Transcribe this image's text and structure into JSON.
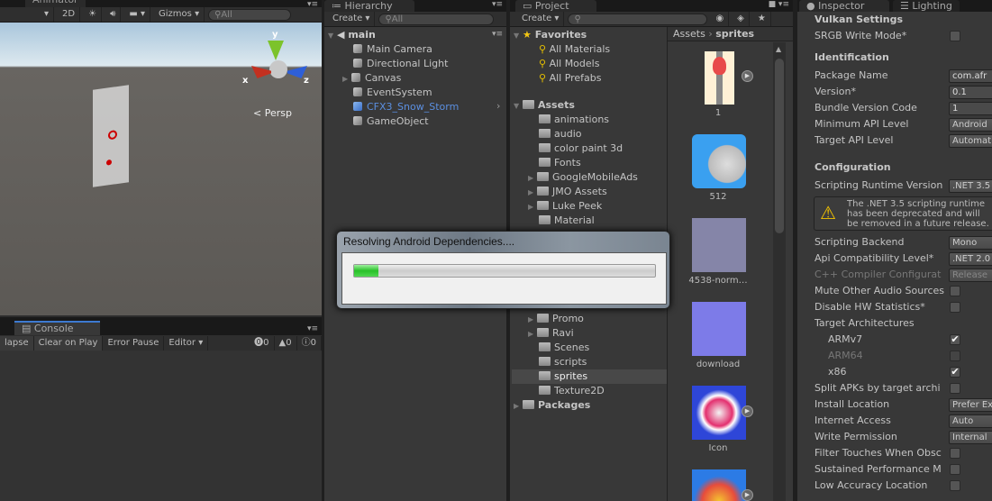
{
  "scene": {
    "tab": "Animator",
    "toolbar": {
      "mode_2d": "2D",
      "gizmos": "Gizmos",
      "search_placeholder": "All"
    },
    "axes": {
      "x": "x",
      "y": "y",
      "z": "z"
    },
    "projection": "Persp"
  },
  "console": {
    "tab": "Console",
    "buttons": [
      "lapse",
      "Clear on Play",
      "Error Pause",
      "Editor"
    ],
    "counts": {
      "errors": "0",
      "warnings": "0",
      "messages": "0"
    }
  },
  "hierarchy": {
    "tab": "Hierarchy",
    "create": "Create",
    "search_placeholder": "All",
    "scene": "main",
    "items": [
      {
        "label": "Main Camera"
      },
      {
        "label": "Directional Light"
      },
      {
        "label": "Canvas"
      },
      {
        "label": "EventSystem"
      },
      {
        "label": "CFX3_Snow_Storm"
      },
      {
        "label": "GameObject"
      }
    ]
  },
  "project": {
    "tab": "Project",
    "create": "Create",
    "favorites": {
      "label": "Favorites",
      "items": [
        "All Materials",
        "All Models",
        "All Prefabs"
      ]
    },
    "assets": {
      "label": "Assets",
      "folders": [
        "animations",
        "audio",
        "color paint 3d",
        "Fonts",
        "GoogleMobileAds",
        "JMO Assets",
        "Luke Peek",
        "Material"
      ],
      "folders_lower": [
        "Promo",
        "Ravi",
        "Scenes",
        "scripts",
        "sprites",
        "Texture2D"
      ]
    },
    "packages": "Packages",
    "breadcrumb": [
      "Assets",
      "sprites"
    ],
    "files": [
      {
        "name": "1"
      },
      {
        "name": "512"
      },
      {
        "name": "4538-norm…"
      },
      {
        "name": "download"
      },
      {
        "name": "Icon"
      }
    ]
  },
  "inspector": {
    "tab": "Inspector",
    "tab2": "Lighting",
    "vulkan": {
      "title": "Vulkan Settings",
      "srgb": "SRGB Write Mode*"
    },
    "identification": {
      "title": "Identification",
      "package_name": "Package Name",
      "package_value": "com.afr",
      "version": "Version*",
      "version_value": "0.1",
      "bundle": "Bundle Version Code",
      "bundle_value": "1",
      "min_api": "Minimum API Level",
      "min_api_value": "Android",
      "target_api": "Target API Level",
      "target_api_value": "Automat"
    },
    "configuration": {
      "title": "Configuration",
      "runtime": "Scripting Runtime Version",
      "runtime_value": ".NET 3.5",
      "warning": "The .NET 3.5 scripting runtime has been deprecated and will be removed in a future release.",
      "backend": "Scripting Backend",
      "backend_value": "Mono",
      "api_compat": "Api Compatibility Level*",
      "api_compat_value": ".NET 2.0",
      "cpp": "C++ Compiler Configurat",
      "cpp_value": "Release",
      "mute": "Mute Other Audio Sources",
      "hw": "Disable HW Statistics*",
      "target_arch": "Target Architectures",
      "armv7": "ARMv7",
      "arm64": "ARM64",
      "x86": "x86",
      "split": "Split APKs by target archi",
      "install": "Install Location",
      "install_value": "Prefer Ex",
      "internet": "Internet Access",
      "internet_value": "Auto",
      "write": "Write Permission",
      "write_value": "Internal",
      "filter": "Filter Touches When Obsc",
      "sustained": "Sustained Performance M",
      "low_acc": "Low Accuracy Location"
    }
  },
  "dialog": {
    "title": "Resolving Android Dependencies....",
    "progress_percent": 8
  }
}
